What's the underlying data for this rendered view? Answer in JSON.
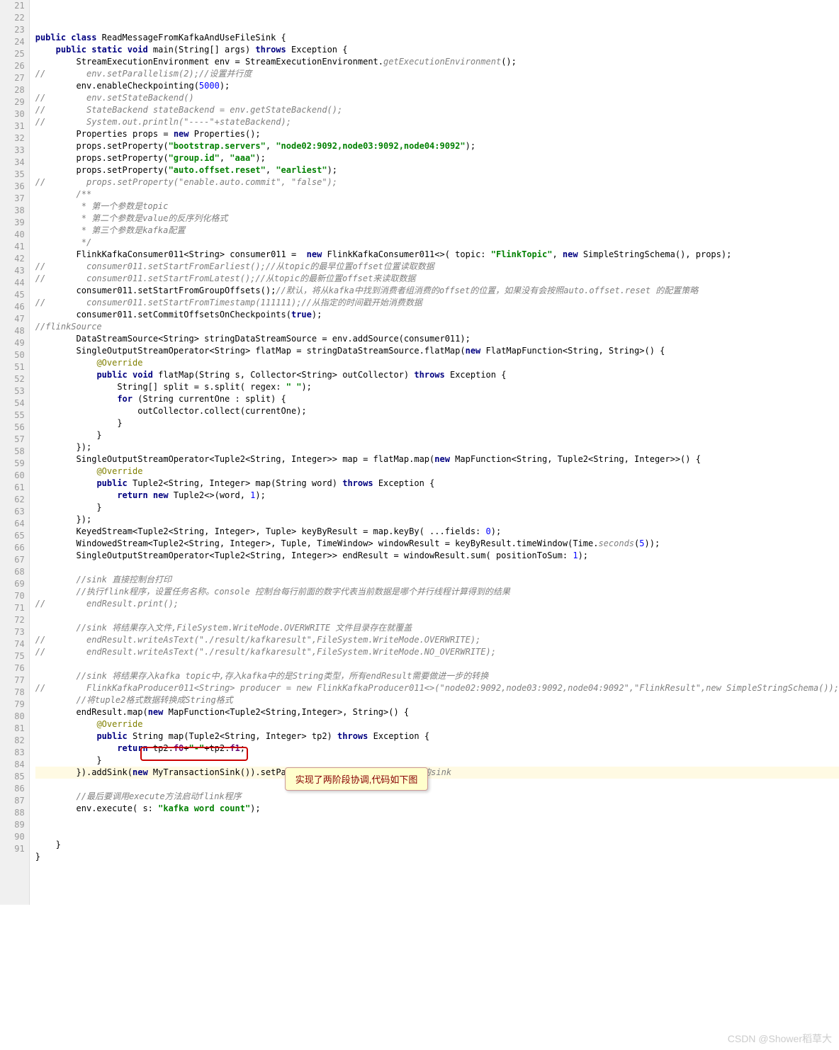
{
  "lines": [
    {
      "n": 21,
      "h": ""
    },
    {
      "n": 22,
      "h": "<span class='k'>public class</span> ReadMessageFromKafkaAndUseFileSink {"
    },
    {
      "n": 23,
      "h": "    <span class='k'>public static void</span> main(String[] args) <span class='k'>throws</span> Exception {"
    },
    {
      "n": 24,
      "h": "        StreamExecutionEnvironment env = StreamExecutionEnvironment.<span class='m'>getExecutionEnvironment</span>();"
    },
    {
      "n": 25,
      "h": "<span class='c'>//        env.setParallelism(2);//设置并行度</span>"
    },
    {
      "n": 26,
      "h": "        env.enableCheckpointing(<span class='n'>5000</span>);"
    },
    {
      "n": 27,
      "h": "<span class='c'>//        env.setStateBackend()</span>"
    },
    {
      "n": 28,
      "h": "<span class='c'>//        StateBackend stateBackend = env.getStateBackend();</span>"
    },
    {
      "n": 29,
      "h": "<span class='c'>//        System.out.println(\"----\"+stateBackend);</span>"
    },
    {
      "n": 30,
      "h": "        Properties props = <span class='k'>new</span> Properties();"
    },
    {
      "n": 31,
      "h": "        props.setProperty(<span class='s'>\"bootstrap.servers\"</span>, <span class='s'>\"node02:9092,node03:9092,node04:9092\"</span>);"
    },
    {
      "n": 32,
      "h": "        props.setProperty(<span class='s'>\"group.id\"</span>, <span class='s'>\"aaa\"</span>);"
    },
    {
      "n": 33,
      "h": "        props.setProperty(<span class='s'>\"auto.offset.reset\"</span>, <span class='s'>\"earliest\"</span>);"
    },
    {
      "n": 34,
      "h": "<span class='c'>//        props.setProperty(\"enable.auto.commit\", \"false\");</span>"
    },
    {
      "n": 35,
      "h": "        <span class='c'>/**</span>"
    },
    {
      "n": 36,
      "h": "<span class='c'>         * 第一个参数是topic</span>"
    },
    {
      "n": 37,
      "h": "<span class='c'>         * 第二个参数是value的反序列化格式</span>"
    },
    {
      "n": 38,
      "h": "<span class='c'>         * 第三个参数是kafka配置</span>"
    },
    {
      "n": 39,
      "h": "<span class='c'>         */</span>"
    },
    {
      "n": 40,
      "h": "        FlinkKafkaConsumer011&lt;String&gt; consumer011 =  <span class='k'>new</span> FlinkKafkaConsumer011&lt;&gt;( topic: <span class='s'>\"FlinkTopic\"</span>, <span class='k'>new</span> SimpleStringSchema(), props);"
    },
    {
      "n": 41,
      "h": "<span class='c'>//        consumer011.setStartFromEarliest();//从topic的最早位置offset位置读取数据</span>"
    },
    {
      "n": 42,
      "h": "<span class='c'>//        consumer011.setStartFromLatest();//从topic的最新位置offset来读取数据</span>"
    },
    {
      "n": 43,
      "h": "        consumer011.setStartFromGroupOffsets();<span class='c'>//默认，将从kafka中找到消费者组消费的offset的位置，如果没有会按照auto.offset.reset 的配置策略</span>"
    },
    {
      "n": 44,
      "h": "<span class='c'>//        consumer011.setStartFromTimestamp(111111);//从指定的时间戳开始消费数据</span>"
    },
    {
      "n": 45,
      "h": "        consumer011.setCommitOffsetsOnCheckpoints(<span class='k'>true</span>);"
    },
    {
      "n": 46,
      "h": "<span class='c'>//flinkSource</span>"
    },
    {
      "n": 47,
      "h": "        DataStreamSource&lt;String&gt; stringDataStreamSource = env.addSource(consumer011);"
    },
    {
      "n": 48,
      "h": "        SingleOutputStreamOperator&lt;String&gt; flatMap = stringDataStreamSource.flatMap(<span class='k'>new</span> FlatMapFunction&lt;String, String&gt;() {"
    },
    {
      "n": 49,
      "h": "            <span class='a'>@Override</span>"
    },
    {
      "n": 50,
      "h": "            <span class='k'>public void</span> flatMap(String s, Collector&lt;String&gt; outCollector) <span class='k'>throws</span> Exception {"
    },
    {
      "n": 51,
      "h": "                String[] split = s.split( regex: <span class='s'>\" \"</span>);"
    },
    {
      "n": 52,
      "h": "                <span class='k'>for</span> (String currentOne : split) {"
    },
    {
      "n": 53,
      "h": "                    outCollector.collect(currentOne);"
    },
    {
      "n": 54,
      "h": "                }"
    },
    {
      "n": 55,
      "h": "            }"
    },
    {
      "n": 56,
      "h": "        });"
    },
    {
      "n": 57,
      "h": "        SingleOutputStreamOperator&lt;Tuple2&lt;String, Integer&gt;&gt; map = flatMap.map(<span class='k'>new</span> MapFunction&lt;String, Tuple2&lt;String, Integer&gt;&gt;() {"
    },
    {
      "n": 58,
      "h": "            <span class='a'>@Override</span>"
    },
    {
      "n": 59,
      "h": "            <span class='k'>public</span> Tuple2&lt;String, Integer&gt; map(String word) <span class='k'>throws</span> Exception {"
    },
    {
      "n": 60,
      "h": "                <span class='k'>return new</span> Tuple2&lt;&gt;(word, <span class='n'>1</span>);"
    },
    {
      "n": 61,
      "h": "            }"
    },
    {
      "n": 62,
      "h": "        });"
    },
    {
      "n": 63,
      "h": "        KeyedStream&lt;Tuple2&lt;String, Integer&gt;, Tuple&gt; keyByResult = map.keyBy( ...fields: <span class='n'>0</span>);"
    },
    {
      "n": 64,
      "h": "        WindowedStream&lt;Tuple2&lt;String, Integer&gt;, Tuple, TimeWindow&gt; windowResult = keyByResult.timeWindow(Time.<span class='m'>seconds</span>(<span class='n'>5</span>));"
    },
    {
      "n": 65,
      "h": "        SingleOutputStreamOperator&lt;Tuple2&lt;String, Integer&gt;&gt; endResult = windowResult.sum( positionToSum: <span class='n'>1</span>);"
    },
    {
      "n": 66,
      "h": ""
    },
    {
      "n": 67,
      "h": "        <span class='c'>//sink 直接控制台打印</span>"
    },
    {
      "n": 68,
      "h": "        <span class='c'>//执行flink程序，设置任务名称。console 控制台每行前面的数字代表当前数据是哪个并行线程计算得到的结果</span>"
    },
    {
      "n": 69,
      "h": "<span class='c'>//        endResult.print();</span>"
    },
    {
      "n": 70,
      "h": ""
    },
    {
      "n": 71,
      "h": "        <span class='c'>//sink 将结果存入文件,FileSystem.WriteMode.OVERWRITE 文件目录存在就覆盖</span>"
    },
    {
      "n": 72,
      "h": "<span class='c'>//        endResult.writeAsText(\"./result/kafkaresult\",FileSystem.WriteMode.OVERWRITE);</span>"
    },
    {
      "n": 73,
      "h": "<span class='c'>//        endResult.writeAsText(\"./result/kafkaresult\",FileSystem.WriteMode.NO_OVERWRITE);</span>"
    },
    {
      "n": 74,
      "h": ""
    },
    {
      "n": 75,
      "h": "        <span class='c'>//sink 将结果存入kafka topic中,存入kafka中的是String类型，所有endResult需要做进一步的转换</span>"
    },
    {
      "n": 76,
      "h": "<span class='c'>//        FlinkKafkaProducer011&lt;String&gt; producer = new FlinkKafkaProducer011&lt;&gt;(\"node02:9092,node03:9092,node04:9092\",\"FlinkResult\",new SimpleStringSchema());</span>"
    },
    {
      "n": 77,
      "h": "        <span class='c'>//将tuple2格式数据转换成String格式</span>"
    },
    {
      "n": 78,
      "h": "        endResult.map(<span class='k'>new</span> MapFunction&lt;Tuple2&lt;String,Integer&gt;, String&gt;() {"
    },
    {
      "n": 79,
      "h": "            <span class='a'>@Override</span>"
    },
    {
      "n": 80,
      "h": "            <span class='k'>public</span> String map(Tuple2&lt;String, Integer&gt; tp2) <span class='k'>throws</span> Exception {"
    },
    {
      "n": 81,
      "h": "                <span class='k'>return</span> tp2.<span class='p'>f0</span>+<span class='s'>\"-\"</span>+tp2.<span class='p'>f1</span>;"
    },
    {
      "n": 82,
      "h": "            }"
    },
    {
      "n": 83,
      "h": "        }).addSink(<span class='k'>new</span> MyTransactionSink()).setParallelism(<span class='n'>1</span>);<span class='c'>//此处使用自定义的sink</span>",
      "hl": true
    },
    {
      "n": 84,
      "h": ""
    },
    {
      "n": 85,
      "h": "        <span class='c'>//最后要调用execute方法启动flink程序</span>"
    },
    {
      "n": 86,
      "h": "        env.execute( s: <span class='s'>\"kafka word count\"</span>);"
    },
    {
      "n": 87,
      "h": ""
    },
    {
      "n": 88,
      "h": ""
    },
    {
      "n": 89,
      "h": "    }"
    },
    {
      "n": 90,
      "h": "}"
    },
    {
      "n": 91,
      "h": ""
    }
  ],
  "callout": "实现了两阶段协调,代码如下图",
  "watermark": "CSDN @Shower稻草大"
}
